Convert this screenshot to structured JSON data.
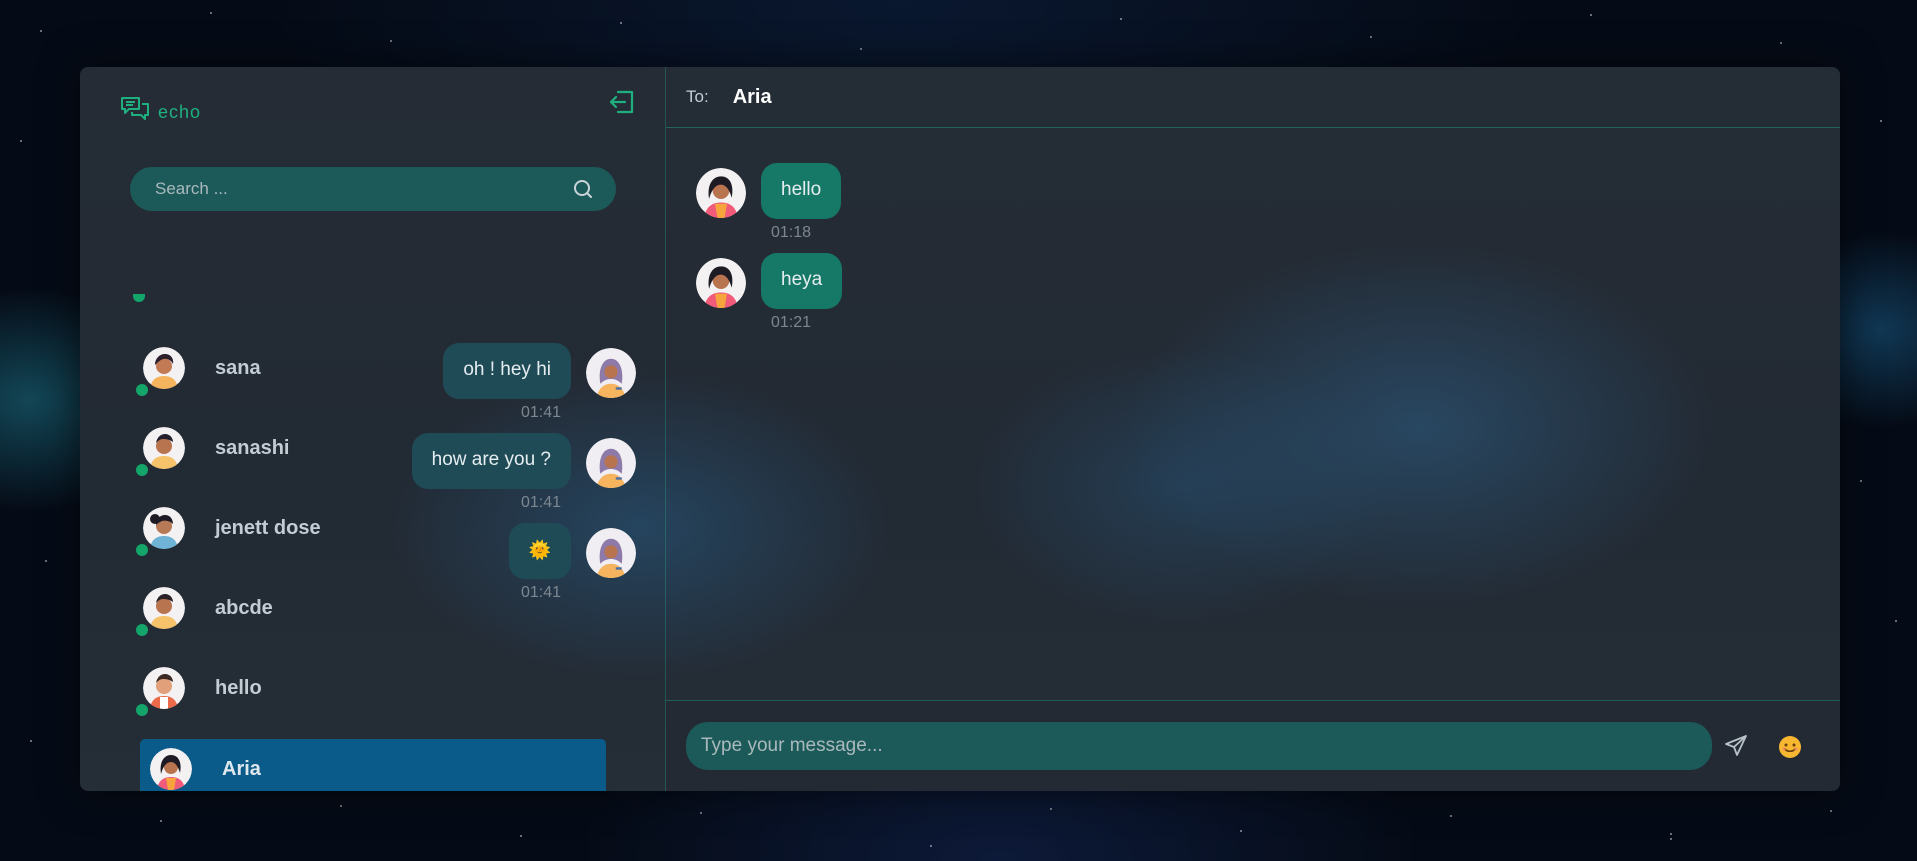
{
  "app": {
    "brand": "echo",
    "accent_color": "#1fb07f",
    "logout_icon": "logout-icon"
  },
  "search": {
    "placeholder": "Search ...",
    "icon": "search-icon"
  },
  "contacts": [
    {
      "name": "sana",
      "online": true,
      "avatar": "woman-avatar"
    },
    {
      "name": "sanashi",
      "online": true,
      "avatar": "man-avatar"
    },
    {
      "name": "jenett dose",
      "online": true,
      "avatar": "woman-avatar"
    },
    {
      "name": "abcde",
      "online": true,
      "avatar": "man-avatar"
    },
    {
      "name": "hello",
      "online": true,
      "avatar": "man-avatar"
    },
    {
      "name": "Aria",
      "online": true,
      "active": true,
      "avatar": "woman-avatar"
    }
  ],
  "chat": {
    "to_label": "To:",
    "recipient": "Aria",
    "messages": [
      {
        "direction": "in",
        "text": "hello",
        "time": "01:18"
      },
      {
        "direction": "in",
        "text": "heya",
        "time": "01:21"
      },
      {
        "direction": "out",
        "text": "oh ! hey hi",
        "time": "01:41"
      },
      {
        "direction": "out",
        "text": "how are you ?",
        "time": "01:41"
      },
      {
        "direction": "out",
        "text": "🌞",
        "time": "01:41"
      }
    ],
    "composer": {
      "placeholder": "Type your message...",
      "send_icon": "send-icon",
      "emoji_icon": "emoji-icon"
    }
  }
}
